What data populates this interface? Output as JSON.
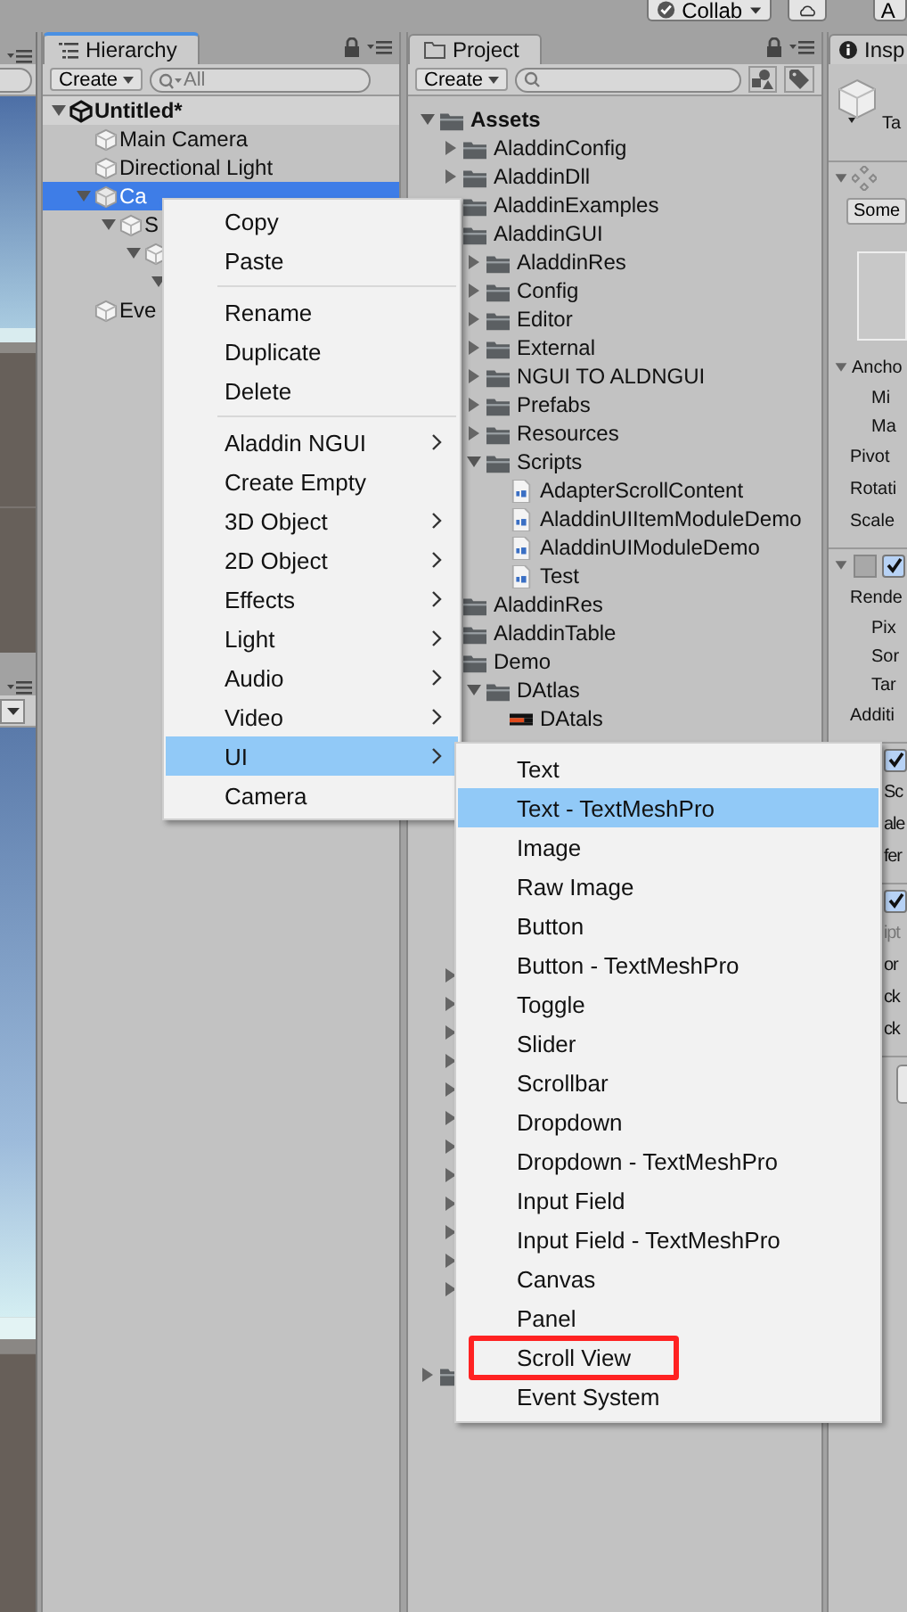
{
  "toolbar": {
    "collab": "Collab",
    "account": "A"
  },
  "hierarchy": {
    "tab": "Hierarchy",
    "create": "Create",
    "search_placeholder": "All",
    "tree": [
      {
        "name": "Untitled*",
        "kind": "scene",
        "expanded": true,
        "selected": false,
        "children": [
          {
            "name": "Main Camera",
            "kind": "object",
            "selected": false
          },
          {
            "name": "Directional Light",
            "kind": "object",
            "selected": false
          },
          {
            "name": "Ca",
            "kind": "object",
            "expanded": true,
            "selected": true,
            "children": [
              {
                "name": "S",
                "kind": "object",
                "expanded": true,
                "selected": false,
                "children": [
                  {
                    "kind": "object",
                    "expanded": true,
                    "selected": false,
                    "children": [
                      {
                        "expanded": true,
                        "selected": false
                      }
                    ]
                  }
                ]
              }
            ]
          },
          {
            "name": "Eve",
            "kind": "object",
            "selected": false
          }
        ]
      }
    ]
  },
  "project": {
    "tab": "Project",
    "create": "Create",
    "tree": [
      {
        "name": "Assets",
        "kind": "folder",
        "expanded": true,
        "children": [
          {
            "name": "AladdinConfig",
            "kind": "folder",
            "expanded": false
          },
          {
            "name": "AladdinDll",
            "kind": "folder",
            "expanded": false
          },
          {
            "name": "AladdinExamples",
            "kind": "folder"
          },
          {
            "name": "AladdinGUI",
            "kind": "folder",
            "children": [
              {
                "name": "AladdinRes",
                "kind": "folder",
                "expanded": false
              },
              {
                "name": "Config",
                "kind": "folder",
                "expanded": false
              },
              {
                "name": "Editor",
                "kind": "folder",
                "expanded": false
              },
              {
                "name": "External",
                "kind": "folder",
                "expanded": false
              },
              {
                "name": "NGUI TO ALDNGUI",
                "kind": "folder",
                "expanded": false
              },
              {
                "name": "Prefabs",
                "kind": "folder",
                "expanded": false
              },
              {
                "name": "Resources",
                "kind": "folder",
                "expanded": false
              },
              {
                "name": "Scripts",
                "kind": "folder",
                "expanded": true,
                "children": [
                  {
                    "name": "AdapterScrollContent",
                    "kind": "script"
                  },
                  {
                    "name": "AladdinUIItemModuleDemo",
                    "kind": "script"
                  },
                  {
                    "name": "AladdinUIModuleDemo",
                    "kind": "script"
                  },
                  {
                    "name": "Test",
                    "kind": "script"
                  }
                ]
              }
            ]
          },
          {
            "name": "AladdinRes",
            "kind": "folder"
          },
          {
            "name": "AladdinTable",
            "kind": "folder"
          },
          {
            "name": "Demo",
            "kind": "folder",
            "children": [
              {
                "name": "DAtlas",
                "kind": "folder",
                "expanded": true,
                "children": [
                  {
                    "name": "DAtals",
                    "kind": "atlas"
                  }
                ]
              }
            ]
          },
          {
            "expanded": false
          },
          {
            "expanded": false
          },
          {
            "expanded": false
          },
          {
            "expanded": false
          },
          {
            "expanded": false
          },
          {
            "expanded": false
          },
          {
            "expanded": false
          },
          {
            "expanded": false
          },
          {
            "expanded": false
          },
          {
            "expanded": false
          },
          {
            "expanded": false
          },
          {
            "expanded": false
          }
        ]
      },
      {
        "kind": "folder",
        "expanded": false
      }
    ]
  },
  "inspector": {
    "tab": "Insp",
    "name_label": "Ta",
    "layer": "Some",
    "rows": [
      {
        "kind": "section",
        "text": "Ancho",
        "expanded": true
      },
      {
        "kind": "sub",
        "text": "Mi"
      },
      {
        "kind": "sub",
        "text": "Ma"
      },
      {
        "kind": "field",
        "text": "Pivot"
      },
      {
        "kind": "field",
        "text": "Rotati"
      },
      {
        "kind": "field",
        "text": "Scale"
      },
      {
        "kind": "component",
        "expanded": true,
        "checked": true
      },
      {
        "kind": "field",
        "text": "Rende"
      },
      {
        "kind": "sub",
        "text": "Pix"
      },
      {
        "kind": "sub",
        "text": "Sor"
      },
      {
        "kind": "sub",
        "text": "Tar"
      },
      {
        "kind": "field",
        "text": "Additi"
      },
      {
        "kind": "check",
        "checked": true
      },
      {
        "kind": "clipped",
        "text": "Sc"
      },
      {
        "kind": "clipped",
        "text": "ale"
      },
      {
        "kind": "clipped",
        "text": "fer"
      },
      {
        "kind": "check",
        "checked": true
      },
      {
        "kind": "dim",
        "text": "ipt"
      },
      {
        "kind": "clipped",
        "text": "or"
      },
      {
        "kind": "clipped",
        "text": "ck"
      },
      {
        "kind": "clipped",
        "text": "ck"
      },
      {
        "kind": "button"
      }
    ]
  },
  "context_menu": {
    "items": [
      {
        "kind": "item",
        "label": "Copy",
        "submenu": false,
        "selected": false
      },
      {
        "kind": "item",
        "label": "Paste",
        "submenu": false,
        "selected": false
      },
      {
        "kind": "separator"
      },
      {
        "kind": "item",
        "label": "Rename",
        "submenu": false,
        "selected": false
      },
      {
        "kind": "item",
        "label": "Duplicate",
        "submenu": false,
        "selected": false
      },
      {
        "kind": "item",
        "label": "Delete",
        "submenu": false,
        "selected": false
      },
      {
        "kind": "separator"
      },
      {
        "kind": "item",
        "label": "Aladdin NGUI",
        "submenu": true,
        "selected": false
      },
      {
        "kind": "item",
        "label": "Create Empty",
        "submenu": false,
        "selected": false
      },
      {
        "kind": "item",
        "label": "3D Object",
        "submenu": true,
        "selected": false
      },
      {
        "kind": "item",
        "label": "2D Object",
        "submenu": true,
        "selected": false
      },
      {
        "kind": "item",
        "label": "Effects",
        "submenu": true,
        "selected": false
      },
      {
        "kind": "item",
        "label": "Light",
        "submenu": true,
        "selected": false
      },
      {
        "kind": "item",
        "label": "Audio",
        "submenu": true,
        "selected": false
      },
      {
        "kind": "item",
        "label": "Video",
        "submenu": true,
        "selected": false
      },
      {
        "kind": "item",
        "label": "UI",
        "submenu": true,
        "selected": true
      },
      {
        "kind": "item",
        "label": "Camera",
        "submenu": false,
        "selected": false
      }
    ]
  },
  "ui_submenu": {
    "items": [
      {
        "label": "Text",
        "selected": false,
        "outlined": false
      },
      {
        "label": "Text - TextMeshPro",
        "selected": true,
        "outlined": false
      },
      {
        "label": "Image",
        "selected": false,
        "outlined": false
      },
      {
        "label": "Raw Image",
        "selected": false,
        "outlined": false
      },
      {
        "label": "Button",
        "selected": false,
        "outlined": false
      },
      {
        "label": "Button - TextMeshPro",
        "selected": false,
        "outlined": false
      },
      {
        "label": "Toggle",
        "selected": false,
        "outlined": false
      },
      {
        "label": "Slider",
        "selected": false,
        "outlined": false
      },
      {
        "label": "Scrollbar",
        "selected": false,
        "outlined": false
      },
      {
        "label": "Dropdown",
        "selected": false,
        "outlined": false
      },
      {
        "label": "Dropdown - TextMeshPro",
        "selected": false,
        "outlined": false
      },
      {
        "label": "Input Field",
        "selected": false,
        "outlined": false
      },
      {
        "label": "Input Field - TextMeshPro",
        "selected": false,
        "outlined": false
      },
      {
        "label": "Canvas",
        "selected": false,
        "outlined": false
      },
      {
        "label": "Panel",
        "selected": false,
        "outlined": false
      },
      {
        "label": "Scroll View",
        "selected": false,
        "outlined": true
      },
      {
        "label": "Event System",
        "selected": false,
        "outlined": false
      }
    ]
  }
}
